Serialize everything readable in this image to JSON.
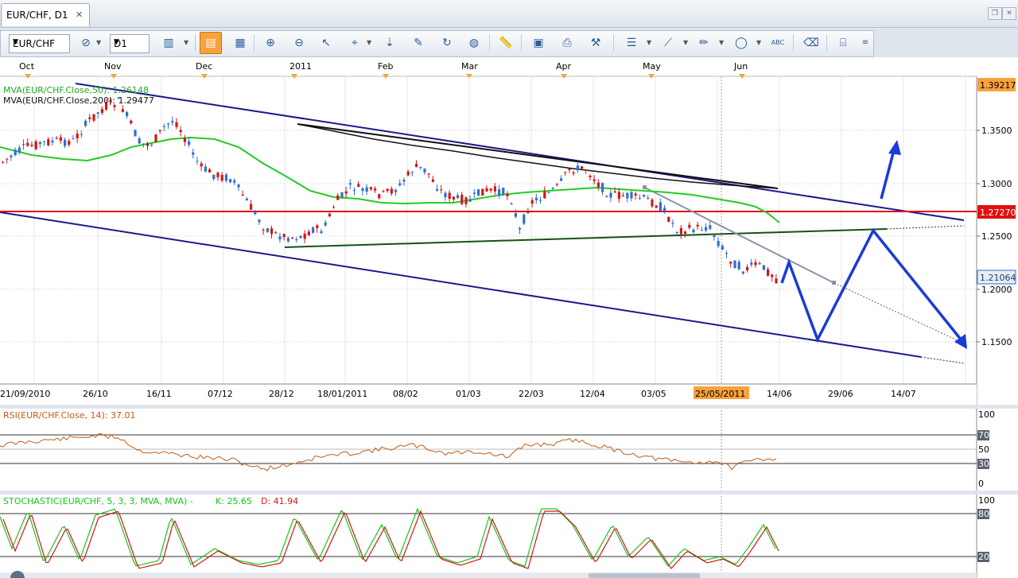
{
  "tab": {
    "title": "EUR/CHF, D1",
    "close": "✕"
  },
  "window": {
    "restore": "❐",
    "close": "✕"
  },
  "toolbar": {
    "symbol": "EUR/CHF",
    "timeframe": "D1"
  },
  "months": [
    "Oct",
    "Nov",
    "Dec",
    "2011",
    "Feb",
    "Mar",
    "Apr",
    "May",
    "Jun"
  ],
  "dates": [
    "21/09/2010",
    "26/10",
    "16/11",
    "07/12",
    "28/12",
    "18/01/2011",
    "08/02",
    "01/03",
    "22/03",
    "12/04",
    "03/05",
    "25/05/2011",
    "14/06",
    "29/06",
    "14/07"
  ],
  "price_axis": {
    "top_price": "1.39217",
    "prices": [
      "1.3500",
      "1.3000",
      "1.2500",
      "1.2000",
      "1.1500"
    ],
    "hline_price": "1.27270",
    "last_price": "1.21064"
  },
  "legend": {
    "ma50": "MVA(EUR/CHF.Close,50): 1.26148",
    "ma200": "MVA(EUR/CHF.Close,200): 1.29477"
  },
  "rsi": {
    "label": "RSI(EUR/CHF.Close, 14): 37.01",
    "axis": [
      "100",
      "70",
      "50",
      "30",
      "0"
    ]
  },
  "stoch": {
    "label": "STOCHASTIC(EUR/CHF, 5, 3, 3, MVA, MVA) -",
    "k": "K: 25.65",
    "d": "D: 41.94",
    "axis": [
      "100",
      "80",
      "20"
    ]
  },
  "colors": {
    "bull": "#2f6fd0",
    "bear": "#d01818",
    "ma50": "#22cc22",
    "ma200": "#111111",
    "channel": "#1a1a8c",
    "hline": "#e01010",
    "support": "#145214",
    "projection": "#1a3bd6",
    "rsi": "#c45a14",
    "stoch_k": "#19c419",
    "stoch_d": "#d01818",
    "axis_highlight": "#f8a23c"
  }
}
